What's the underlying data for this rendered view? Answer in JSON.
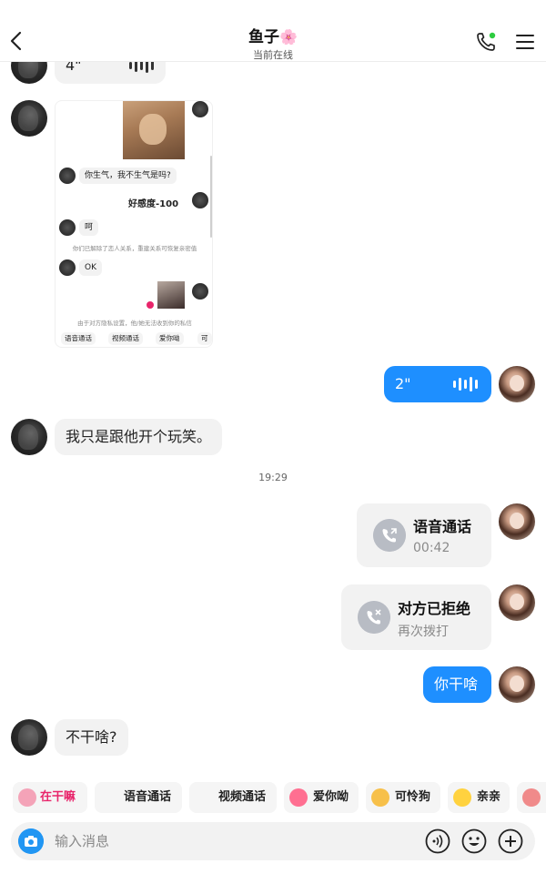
{
  "header": {
    "title": "鱼子",
    "title_emoji": "🌸",
    "status": "当前在线",
    "accent_online": "#2ecc40"
  },
  "messages": {
    "voice_in_duration": "4\"",
    "image_card": {
      "in_text_1": "你生气，我不生气是吗?",
      "out_text_1": "好感度-100",
      "in_text_2": "呵",
      "system_note_1": "你们已解除了恋人关系，重建关系可恢复亲密值",
      "in_text_3": "OK",
      "system_note_2": "由于对方隐私设置，他/她无法收到你的私信",
      "chips": [
        "语音通话",
        "视频通话",
        "爱你呦",
        "可"
      ]
    },
    "voice_out_duration": "2\"",
    "text_in_1": "我只是跟他开个玩笑。",
    "timestamp": "19:29",
    "call_1": {
      "title": "语音通话",
      "sub": "00:42"
    },
    "call_2": {
      "title": "对方已拒绝",
      "sub": "再次拨打"
    },
    "text_out_1": "你干啥",
    "text_in_2": "不干啥?"
  },
  "quick_replies": [
    {
      "label": "在干嘛",
      "color": "#e8256b"
    },
    {
      "label": "语音通话",
      "color": "#222222"
    },
    {
      "label": "视频通话",
      "color": "#222222"
    },
    {
      "label": "爱你呦",
      "color": "#222222"
    },
    {
      "label": "可怜狗",
      "color": "#222222"
    },
    {
      "label": "亲亲",
      "color": "#222222"
    }
  ],
  "input": {
    "placeholder": "输入消息"
  },
  "colors": {
    "bubble_out": "#1e8fff",
    "bubble_in": "#f2f2f2",
    "camera": "#2196f3"
  },
  "icons": [
    "back-arrow-icon",
    "phone-call-icon",
    "menu-icon",
    "voice-wave-icon",
    "call-out-icon",
    "call-rejected-icon",
    "camera-icon",
    "voice-input-icon",
    "emoji-icon",
    "plus-icon"
  ]
}
